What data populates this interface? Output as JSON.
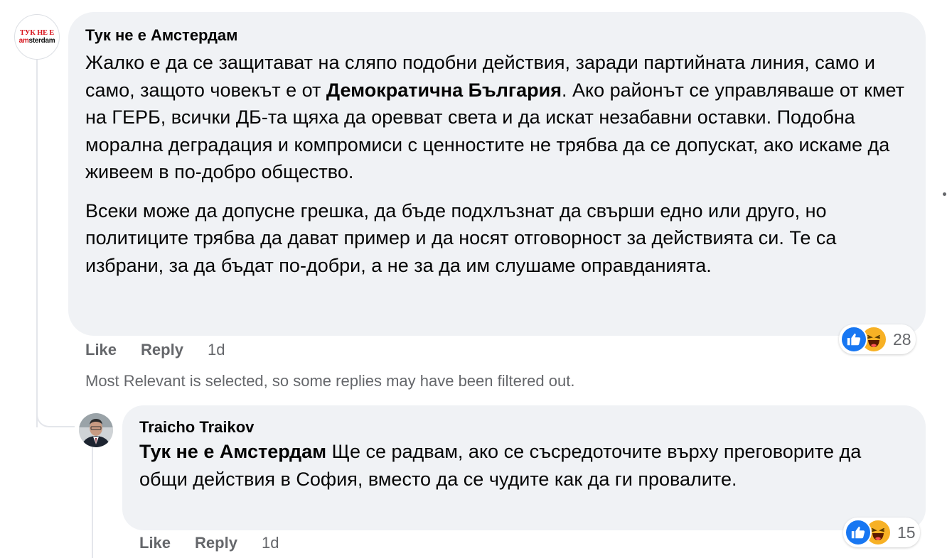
{
  "comment": {
    "author": "Тук не е Амстердам",
    "avatar_logo": {
      "line1": "ТУК НЕ Е",
      "line2_red": "am",
      "line2_rest": "sterdam"
    },
    "paragraph1": {
      "before": "Жалко е да се защитават на сляпо подобни действия, заради партийната линия, само и само, защото човекът е от ",
      "bold": "Демократична България",
      "after": ". Ако районът се управляваше от кмет на ГЕРБ, всички ДБ-та щяха да оревват света и да искат незабавни оставки. Подобна морална деградация и компромиси с ценностите не трябва да се допускат, ако искаме да живеем в по-добро общество."
    },
    "paragraph2": "Всеки може да допусне грешка, да бъде подхлъзнат да свърши едно или друго, но политиците трябва да дават пример и да носят отговорност за действията си. Те са избрани, за да бъдат по-добри, а не за да им слушаме оправданията.",
    "actions": {
      "like": "Like",
      "reply": "Reply",
      "time": "1d"
    },
    "reactions": {
      "icons": [
        "like-icon",
        "haha-icon"
      ],
      "count": "28"
    }
  },
  "filter_note": "Most Relevant is selected, so some replies may have been filtered out.",
  "reply": {
    "author": "Traicho Traikov",
    "mention": "Тук не е Амстердам",
    "text": " Ще се радвам, ако се съсредоточите върху преговорите да общи действия в София, вместо да се чудите как да ги провалите.",
    "actions": {
      "like": "Like",
      "reply": "Reply",
      "time": "1d"
    },
    "reactions": {
      "icons": [
        "like-icon",
        "haha-icon"
      ],
      "count": "15"
    }
  },
  "colors": {
    "bubble": "#f0f2f5",
    "meta_text": "#65676b",
    "like_blue": "#1877f2",
    "haha_yellow": "#f7b125",
    "logo_red": "#d8171f"
  }
}
